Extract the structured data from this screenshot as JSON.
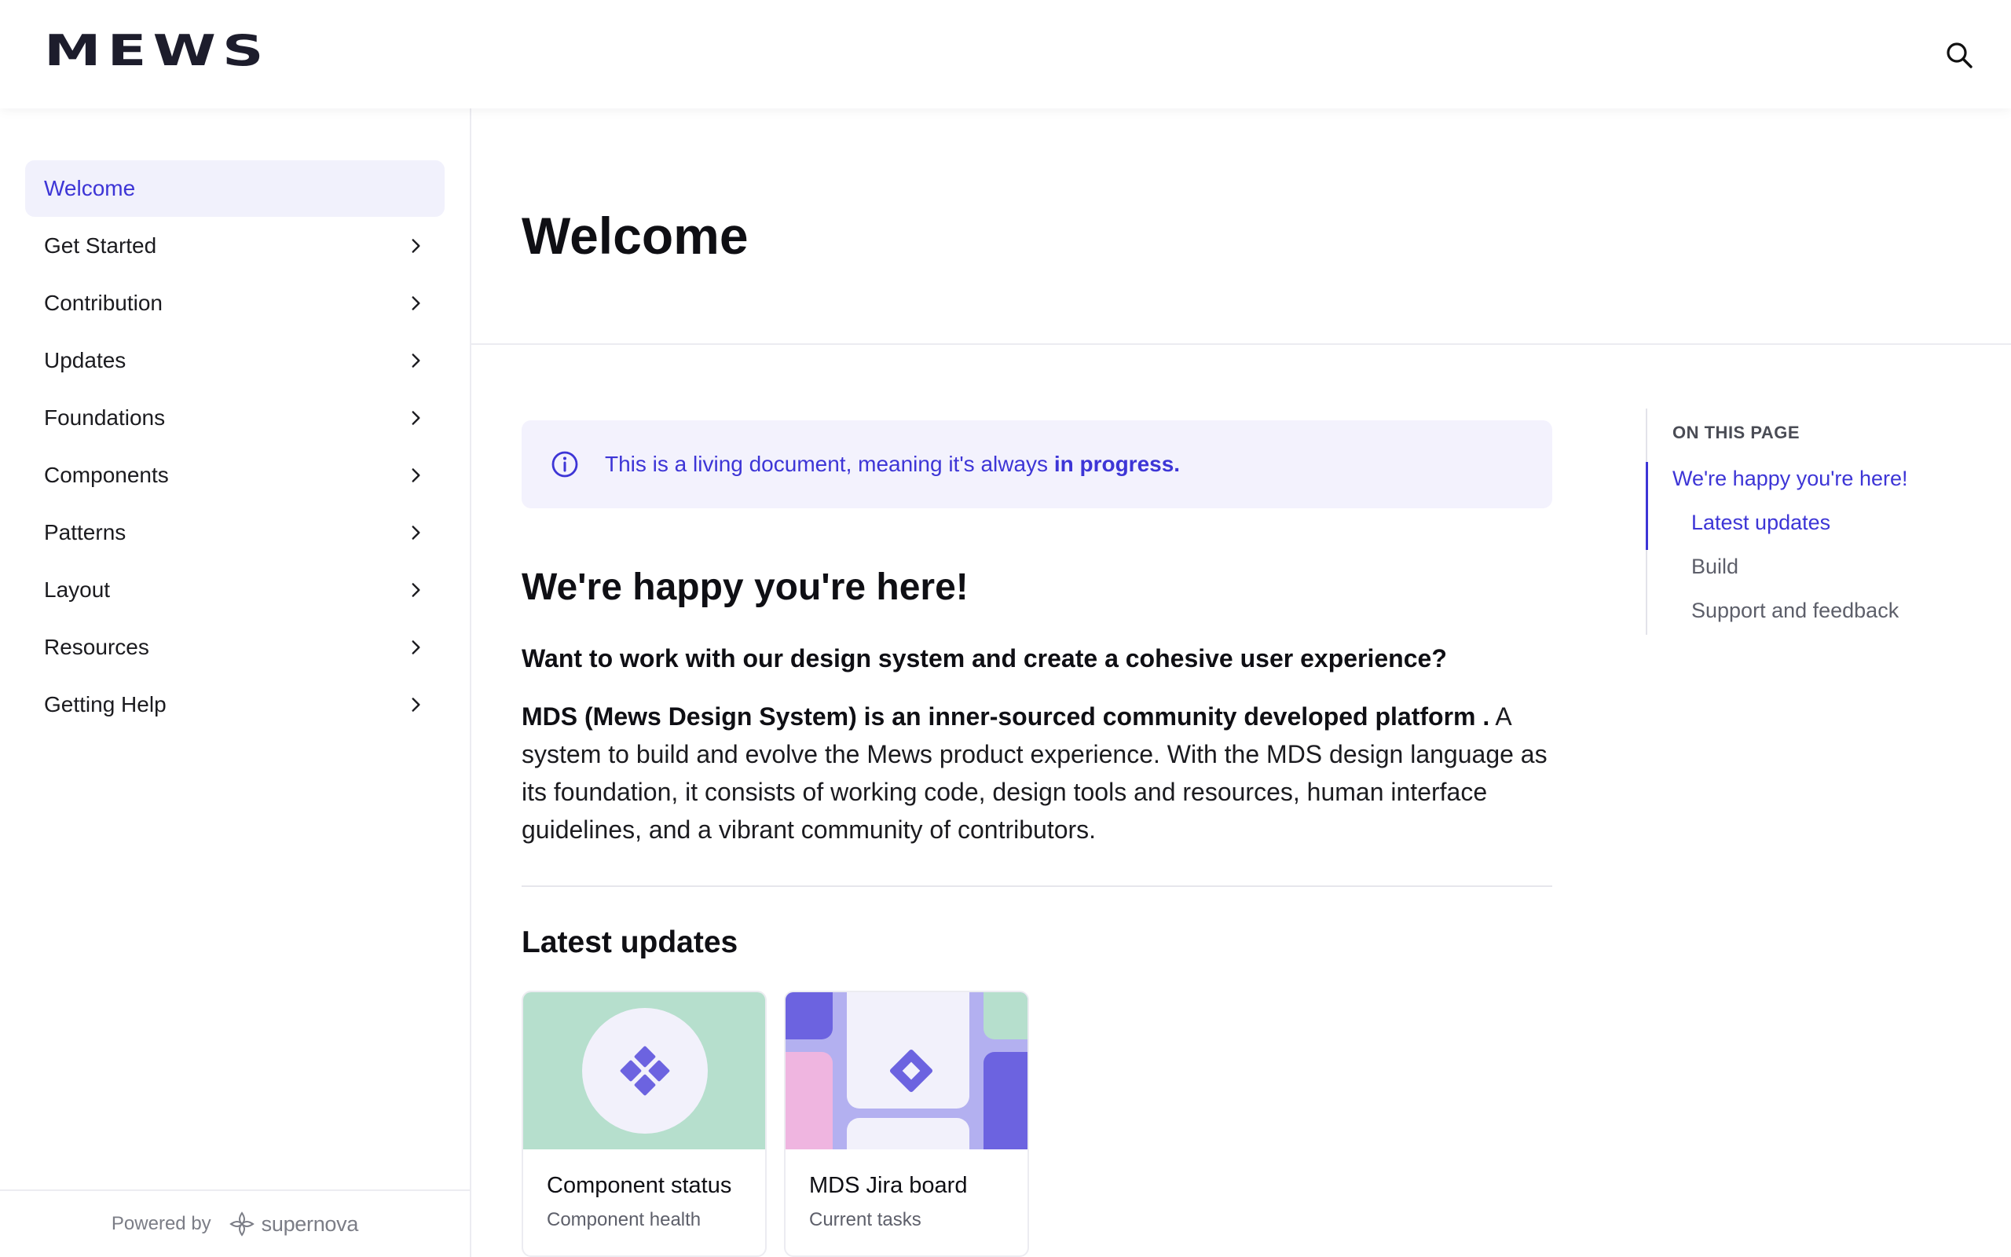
{
  "header": {
    "logo": "MEWS",
    "search_icon": "search-icon"
  },
  "sidebar": {
    "items": [
      {
        "label": "Welcome",
        "active": true,
        "has_chevron": false
      },
      {
        "label": "Get Started",
        "has_chevron": true
      },
      {
        "label": "Contribution",
        "has_chevron": true
      },
      {
        "label": "Updates",
        "has_chevron": true
      },
      {
        "label": "Foundations",
        "has_chevron": true
      },
      {
        "label": "Components",
        "has_chevron": true
      },
      {
        "label": "Patterns",
        "has_chevron": true
      },
      {
        "label": "Layout",
        "has_chevron": true
      },
      {
        "label": "Resources",
        "has_chevron": true
      },
      {
        "label": "Getting Help",
        "has_chevron": true
      }
    ],
    "footer": {
      "powered_by": "Powered by",
      "brand": "supernova"
    }
  },
  "main": {
    "title": "Welcome",
    "callout": {
      "text": "This is a living document, meaning it's always ",
      "emphasis": "in progress."
    },
    "section_title": "We're happy you're here!",
    "lead": "Want to work with our design system and create a cohesive user experience?",
    "paragraph_bold": "MDS (Mews Design System) is an inner-sourced community developed platform .",
    "paragraph_rest": " A system to build and evolve the Mews product experience. With the MDS design language as its foundation, it consists of working code, design tools and resources, human interface guidelines, and a vibrant community of contributors.",
    "updates_title": "Latest updates",
    "cards": [
      {
        "title": "Component status",
        "subtitle": "Component health"
      },
      {
        "title": "MDS Jira board",
        "subtitle": "Current tasks"
      }
    ]
  },
  "toc": {
    "heading": "ON THIS PAGE",
    "items": [
      {
        "label": "We're happy you're here!",
        "state": "active"
      },
      {
        "label": "Latest updates",
        "state": "active"
      },
      {
        "label": "Build",
        "state": "inactive"
      },
      {
        "label": "Support and feedback",
        "state": "inactive"
      }
    ]
  },
  "colors": {
    "accent": "#3d35d6",
    "accent_bg": "#f3f2fd",
    "text": "#1b1b1f",
    "muted": "#5d5f6a",
    "card_green": "#b6dfcd",
    "card_purple": "#6c63e0"
  }
}
